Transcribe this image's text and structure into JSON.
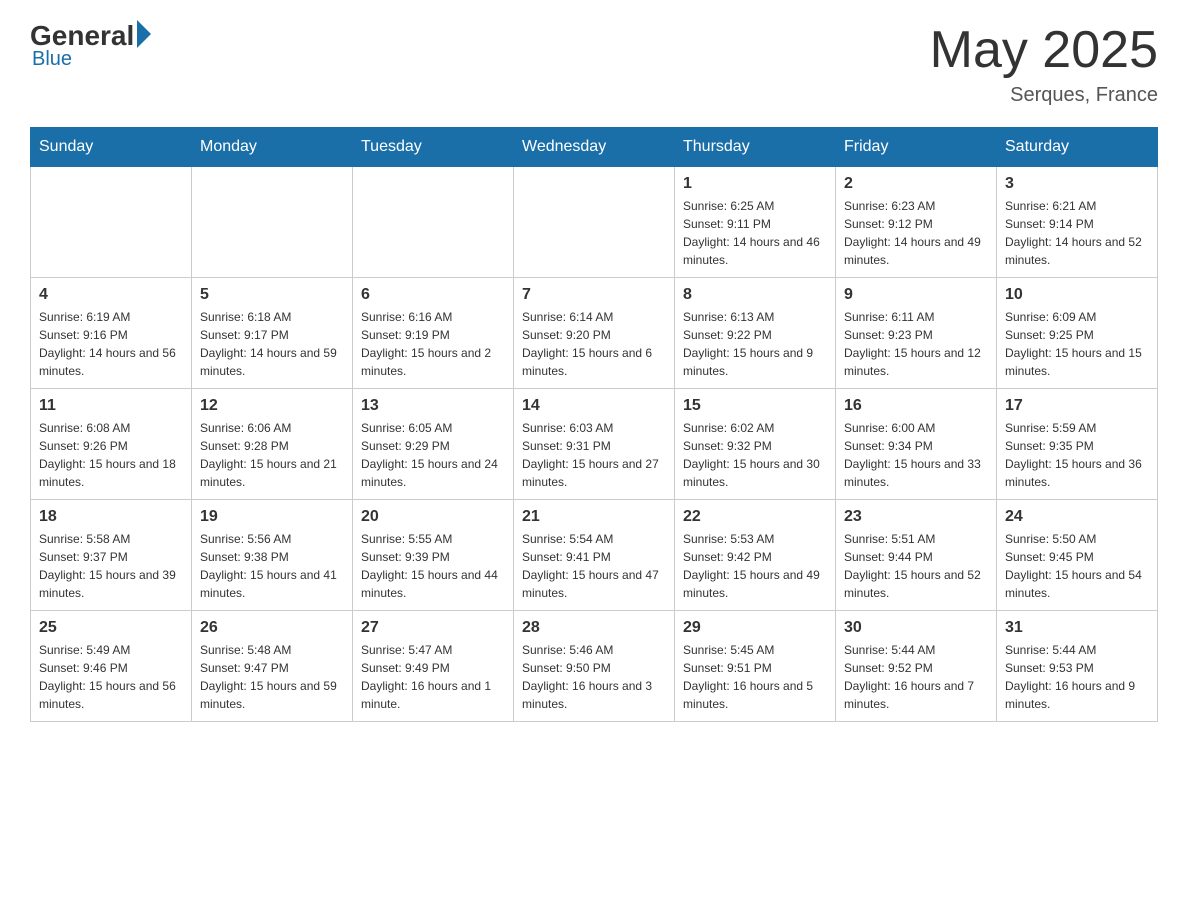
{
  "header": {
    "logo_general": "General",
    "logo_blue": "Blue",
    "month_title": "May 2025",
    "location": "Serques, France"
  },
  "days_of_week": [
    "Sunday",
    "Monday",
    "Tuesday",
    "Wednesday",
    "Thursday",
    "Friday",
    "Saturday"
  ],
  "weeks": [
    [
      {
        "day": "",
        "info": ""
      },
      {
        "day": "",
        "info": ""
      },
      {
        "day": "",
        "info": ""
      },
      {
        "day": "",
        "info": ""
      },
      {
        "day": "1",
        "info": "Sunrise: 6:25 AM\nSunset: 9:11 PM\nDaylight: 14 hours and 46 minutes."
      },
      {
        "day": "2",
        "info": "Sunrise: 6:23 AM\nSunset: 9:12 PM\nDaylight: 14 hours and 49 minutes."
      },
      {
        "day": "3",
        "info": "Sunrise: 6:21 AM\nSunset: 9:14 PM\nDaylight: 14 hours and 52 minutes."
      }
    ],
    [
      {
        "day": "4",
        "info": "Sunrise: 6:19 AM\nSunset: 9:16 PM\nDaylight: 14 hours and 56 minutes."
      },
      {
        "day": "5",
        "info": "Sunrise: 6:18 AM\nSunset: 9:17 PM\nDaylight: 14 hours and 59 minutes."
      },
      {
        "day": "6",
        "info": "Sunrise: 6:16 AM\nSunset: 9:19 PM\nDaylight: 15 hours and 2 minutes."
      },
      {
        "day": "7",
        "info": "Sunrise: 6:14 AM\nSunset: 9:20 PM\nDaylight: 15 hours and 6 minutes."
      },
      {
        "day": "8",
        "info": "Sunrise: 6:13 AM\nSunset: 9:22 PM\nDaylight: 15 hours and 9 minutes."
      },
      {
        "day": "9",
        "info": "Sunrise: 6:11 AM\nSunset: 9:23 PM\nDaylight: 15 hours and 12 minutes."
      },
      {
        "day": "10",
        "info": "Sunrise: 6:09 AM\nSunset: 9:25 PM\nDaylight: 15 hours and 15 minutes."
      }
    ],
    [
      {
        "day": "11",
        "info": "Sunrise: 6:08 AM\nSunset: 9:26 PM\nDaylight: 15 hours and 18 minutes."
      },
      {
        "day": "12",
        "info": "Sunrise: 6:06 AM\nSunset: 9:28 PM\nDaylight: 15 hours and 21 minutes."
      },
      {
        "day": "13",
        "info": "Sunrise: 6:05 AM\nSunset: 9:29 PM\nDaylight: 15 hours and 24 minutes."
      },
      {
        "day": "14",
        "info": "Sunrise: 6:03 AM\nSunset: 9:31 PM\nDaylight: 15 hours and 27 minutes."
      },
      {
        "day": "15",
        "info": "Sunrise: 6:02 AM\nSunset: 9:32 PM\nDaylight: 15 hours and 30 minutes."
      },
      {
        "day": "16",
        "info": "Sunrise: 6:00 AM\nSunset: 9:34 PM\nDaylight: 15 hours and 33 minutes."
      },
      {
        "day": "17",
        "info": "Sunrise: 5:59 AM\nSunset: 9:35 PM\nDaylight: 15 hours and 36 minutes."
      }
    ],
    [
      {
        "day": "18",
        "info": "Sunrise: 5:58 AM\nSunset: 9:37 PM\nDaylight: 15 hours and 39 minutes."
      },
      {
        "day": "19",
        "info": "Sunrise: 5:56 AM\nSunset: 9:38 PM\nDaylight: 15 hours and 41 minutes."
      },
      {
        "day": "20",
        "info": "Sunrise: 5:55 AM\nSunset: 9:39 PM\nDaylight: 15 hours and 44 minutes."
      },
      {
        "day": "21",
        "info": "Sunrise: 5:54 AM\nSunset: 9:41 PM\nDaylight: 15 hours and 47 minutes."
      },
      {
        "day": "22",
        "info": "Sunrise: 5:53 AM\nSunset: 9:42 PM\nDaylight: 15 hours and 49 minutes."
      },
      {
        "day": "23",
        "info": "Sunrise: 5:51 AM\nSunset: 9:44 PM\nDaylight: 15 hours and 52 minutes."
      },
      {
        "day": "24",
        "info": "Sunrise: 5:50 AM\nSunset: 9:45 PM\nDaylight: 15 hours and 54 minutes."
      }
    ],
    [
      {
        "day": "25",
        "info": "Sunrise: 5:49 AM\nSunset: 9:46 PM\nDaylight: 15 hours and 56 minutes."
      },
      {
        "day": "26",
        "info": "Sunrise: 5:48 AM\nSunset: 9:47 PM\nDaylight: 15 hours and 59 minutes."
      },
      {
        "day": "27",
        "info": "Sunrise: 5:47 AM\nSunset: 9:49 PM\nDaylight: 16 hours and 1 minute."
      },
      {
        "day": "28",
        "info": "Sunrise: 5:46 AM\nSunset: 9:50 PM\nDaylight: 16 hours and 3 minutes."
      },
      {
        "day": "29",
        "info": "Sunrise: 5:45 AM\nSunset: 9:51 PM\nDaylight: 16 hours and 5 minutes."
      },
      {
        "day": "30",
        "info": "Sunrise: 5:44 AM\nSunset: 9:52 PM\nDaylight: 16 hours and 7 minutes."
      },
      {
        "day": "31",
        "info": "Sunrise: 5:44 AM\nSunset: 9:53 PM\nDaylight: 16 hours and 9 minutes."
      }
    ]
  ]
}
